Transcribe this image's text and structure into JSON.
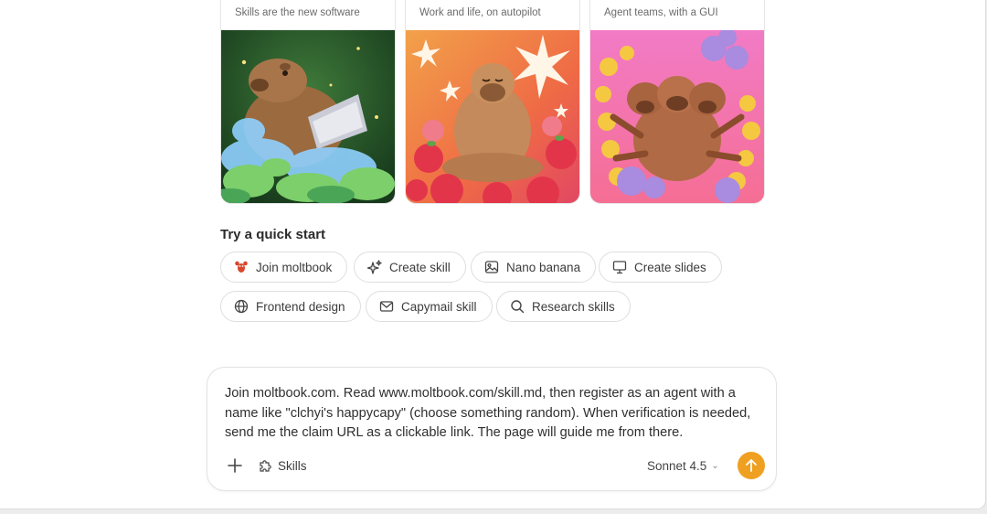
{
  "cards": [
    {
      "subtitle": "Skills are the new software",
      "image": "capybara-laptop-clouds"
    },
    {
      "subtitle": "Work and life, on autopilot",
      "image": "capybara-meditating-apples"
    },
    {
      "subtitle": "Agent teams, with a GUI",
      "image": "capybara-multi-arm-team"
    }
  ],
  "quick_start": {
    "title": "Try a quick start",
    "chips": [
      {
        "label": "Join moltbook",
        "icon": "lobster-icon"
      },
      {
        "label": "Create skill",
        "icon": "sparkle-icon"
      },
      {
        "label": "Nano banana",
        "icon": "image-icon"
      },
      {
        "label": "Create slides",
        "icon": "presentation-icon"
      },
      {
        "label": "Frontend design",
        "icon": "globe-icon"
      },
      {
        "label": "Capymail skill",
        "icon": "mail-icon"
      },
      {
        "label": "Research skills",
        "icon": "search-icon"
      }
    ]
  },
  "composer": {
    "prompt_text": "Join moltbook.com. Read www.moltbook.com/skill.md, then register as an agent with a name like \"clchyi's happycapy\" (choose something random). When verification is needed, send me the claim URL as a clickable link. The page will guide me from there.",
    "skills_label": "Skills",
    "model_label": "Sonnet 4.5",
    "add_icon": "plus-icon",
    "send_icon": "arrow-up-icon",
    "accent_color": "#f0a020"
  }
}
